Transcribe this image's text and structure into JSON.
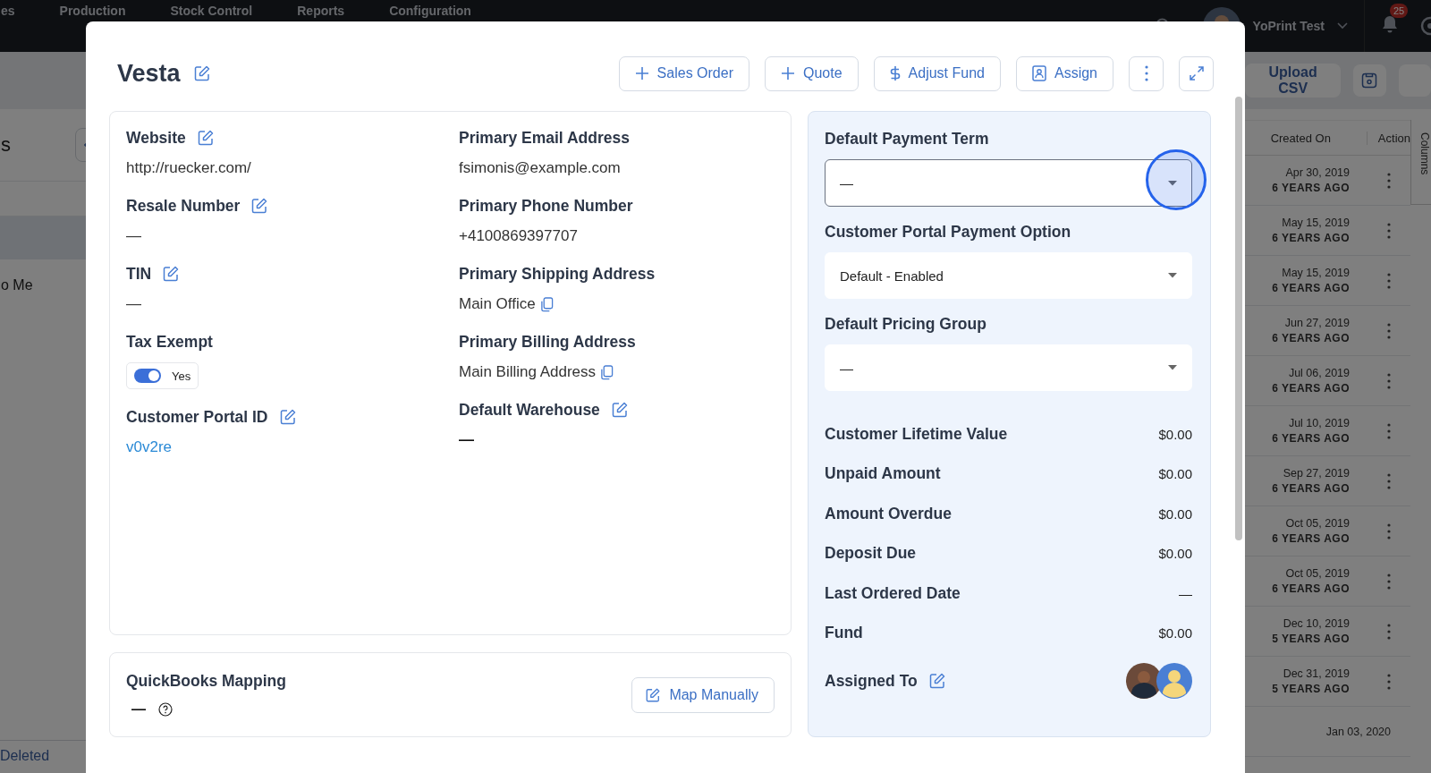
{
  "nav": {
    "items": [
      "es",
      "Production",
      "Stock Control",
      "Reports",
      "Configuration"
    ],
    "user": "YoPrint Test",
    "notifications": "25"
  },
  "background": {
    "left": {
      "title": "s",
      "list_item": "o Me",
      "footer_link": "Deleted"
    },
    "right": {
      "upload_button": "Upload CSV",
      "columns": [
        "Created On",
        "Action"
      ],
      "side_tab": "Columns",
      "rows": [
        {
          "date": "Apr 30, 2019",
          "age": "6 YEARS AGO"
        },
        {
          "date": "May 15, 2019",
          "age": "6 YEARS AGO"
        },
        {
          "date": "May 15, 2019",
          "age": "6 YEARS AGO"
        },
        {
          "date": "Jun 27, 2019",
          "age": "6 YEARS AGO"
        },
        {
          "date": "Jul 06, 2019",
          "age": "6 YEARS AGO"
        },
        {
          "date": "Jul 10, 2019",
          "age": "6 YEARS AGO"
        },
        {
          "date": "Sep 27, 2019",
          "age": "6 YEARS AGO"
        },
        {
          "date": "Oct 05, 2019",
          "age": "6 YEARS AGO"
        },
        {
          "date": "Oct 05, 2019",
          "age": "6 YEARS AGO"
        },
        {
          "date": "Dec 10, 2019",
          "age": "5 YEARS AGO"
        },
        {
          "date": "Dec 31, 2019",
          "age": "5 YEARS AGO"
        },
        {
          "date": "Jan 03, 2020"
        }
      ]
    }
  },
  "modal": {
    "title": "Vesta",
    "header_buttons": [
      {
        "kind": "add",
        "label": "Sales Order"
      },
      {
        "kind": "add",
        "label": "Quote"
      },
      {
        "kind": "fund",
        "label": "Adjust Fund"
      },
      {
        "kind": "assign",
        "label": "Assign"
      }
    ],
    "details": {
      "columns": [
        [
          {
            "label": "Website",
            "editable": true,
            "kind": "text",
            "value": "http://ruecker.com/"
          },
          {
            "label": "Resale Number",
            "editable": true,
            "kind": "text",
            "value": "—"
          },
          {
            "label": "TIN",
            "editable": true,
            "kind": "text",
            "value": "—"
          },
          {
            "label": "Tax Exempt",
            "editable": false,
            "kind": "toggle",
            "on": true,
            "value": "Yes"
          },
          {
            "label": "Customer Portal ID",
            "editable": true,
            "kind": "link",
            "value": "v0v2re"
          }
        ],
        [
          {
            "label": "Primary Email Address",
            "editable": false,
            "kind": "text",
            "value": "fsimonis@example.com"
          },
          {
            "label": "Primary Phone Number",
            "editable": false,
            "kind": "text",
            "value": "+4100869397707"
          },
          {
            "label": "Primary Shipping Address",
            "editable": false,
            "kind": "copy",
            "value": "Main Office"
          },
          {
            "label": "Primary Billing Address",
            "editable": false,
            "kind": "copy",
            "value": "Main Billing Address"
          },
          {
            "label": "Default Warehouse",
            "editable": true,
            "kind": "dash",
            "value": "—"
          }
        ]
      ]
    },
    "quickbooks": {
      "title": "QuickBooks Mapping",
      "value": "—",
      "button": "Map Manually"
    },
    "panel": {
      "selects": [
        {
          "label": "Default Payment Term",
          "value": "—",
          "focused": true
        },
        {
          "label": "Customer Portal Payment Option",
          "value": "Default - Enabled",
          "focused": false
        },
        {
          "label": "Default Pricing Group",
          "value": "—",
          "focused": false
        }
      ],
      "stats": [
        {
          "label": "Customer Lifetime Value",
          "value": "$0.00"
        },
        {
          "label": "Unpaid Amount",
          "value": "$0.00"
        },
        {
          "label": "Amount Overdue",
          "value": "$0.00"
        },
        {
          "label": "Deposit Due",
          "value": "$0.00"
        },
        {
          "label": "Last Ordered Date",
          "value": "—"
        },
        {
          "label": "Fund",
          "value": "$0.00"
        }
      ],
      "assigned": {
        "label": "Assigned To",
        "editable": true,
        "assignees": [
          {
            "kind": "photo"
          },
          {
            "kind": "default"
          }
        ]
      }
    }
  }
}
